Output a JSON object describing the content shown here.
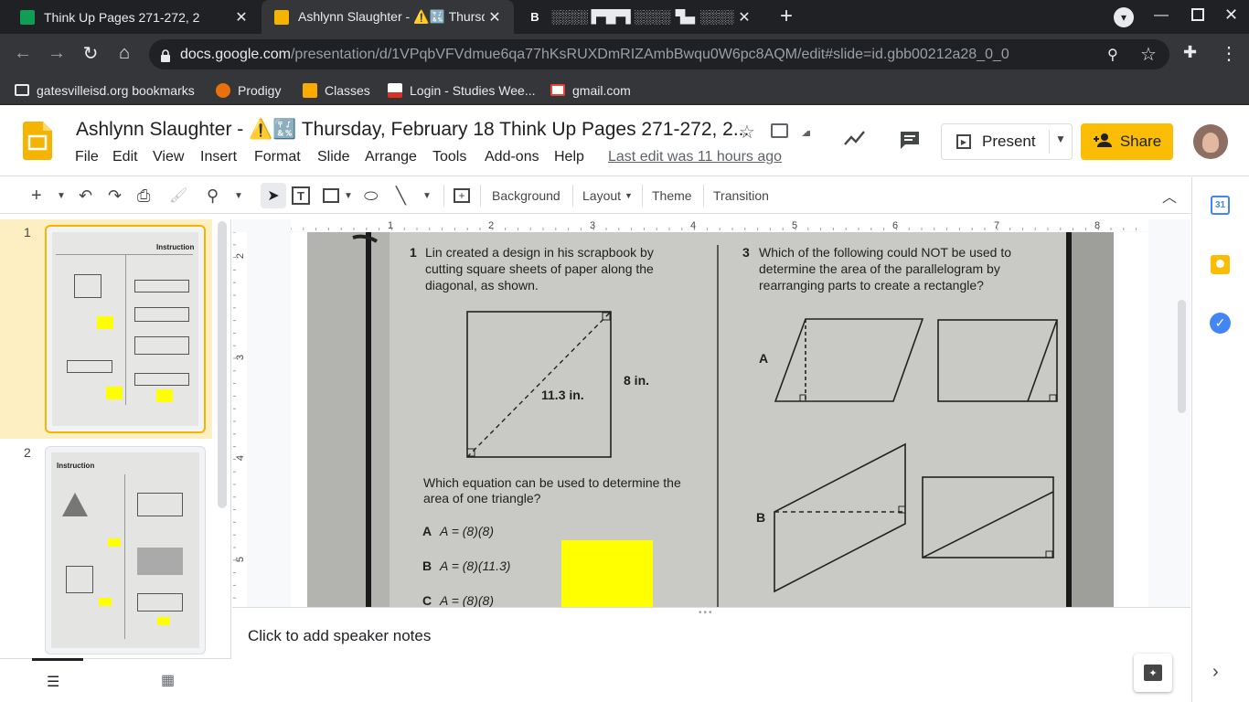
{
  "browser": {
    "tabs": [
      {
        "title": "Think Up Pages 271-272, 2",
        "active": false
      },
      {
        "title": "Ashlynn Slaughter - ⚠️🔣 Thursd",
        "active": true
      },
      {
        "title": "░░░░ ▛▜▛▜ ░░░░▝▙▖░░░░",
        "active": false
      }
    ],
    "new_tab_symbol": "+",
    "url_domain": "docs.google.com",
    "url_path": "/presentation/d/1VPqbVFVdmue6qa77hKsRUXDmRIZAmbBwqu0W6pc8AQM/edit#slide=id.gbb00212a28_0_0",
    "bookmarks": [
      {
        "label": "gatesvilleisd.org bookmarks",
        "icon": "folder-icon"
      },
      {
        "label": "Prodigy",
        "icon": "prodigy-icon"
      },
      {
        "label": "Classes",
        "icon": "classroom-icon"
      },
      {
        "label": "Login - Studies Wee...",
        "icon": "studies-weekly-icon"
      },
      {
        "label": "gmail.com",
        "icon": "gmail-icon"
      }
    ]
  },
  "app": {
    "doc_title": "Ashlynn Slaughter - ⚠️🔣 Thursday, February 18 Think Up Pages 271-272, 2...",
    "menus": [
      "File",
      "Edit",
      "View",
      "Insert",
      "Format",
      "Slide",
      "Arrange",
      "Tools",
      "Add-ons",
      "Help"
    ],
    "last_edit": "Last edit was 11 hours ago",
    "present_label": "Present",
    "share_label": "Share",
    "accent": "#fbbc04"
  },
  "edit_toolbar": {
    "background": "Background",
    "layout": "Layout",
    "theme": "Theme",
    "transition": "Transition"
  },
  "filmstrip": {
    "slides": [
      {
        "number": "1",
        "heading": "Instruction",
        "selected": true
      },
      {
        "number": "2",
        "heading": "Instruction",
        "selected": false
      }
    ]
  },
  "ruler": {
    "h_ticks": [
      "1",
      "2",
      "3",
      "4",
      "5",
      "6",
      "7",
      "8"
    ],
    "v_ticks": [
      "2",
      "3",
      "4",
      "5"
    ]
  },
  "slide": {
    "q1": {
      "number": "1",
      "text": [
        "Lin created a design in his scrapbook by",
        "cutting square sheets of paper along the",
        "diagonal, as shown."
      ],
      "diag_label": "11.3 in.",
      "side_label": "8 in.",
      "prompt": [
        "Which equation can be used to determine the",
        "area of one triangle?"
      ],
      "choices": [
        {
          "letter": "A",
          "text": "A = (8)(8)"
        },
        {
          "letter": "B",
          "text": "A = (8)(11.3)"
        },
        {
          "letter": "C",
          "text": "A = (8)(8)"
        }
      ]
    },
    "q3": {
      "number": "3",
      "text": [
        "Which of the following could NOT be used to",
        "determine the area of the parallelogram by",
        "rearranging parts to create a rectangle?"
      ],
      "options": [
        "A",
        "B"
      ]
    },
    "sticky_color": "#ffff00"
  },
  "notes": {
    "placeholder": "Click to add speaker notes"
  }
}
